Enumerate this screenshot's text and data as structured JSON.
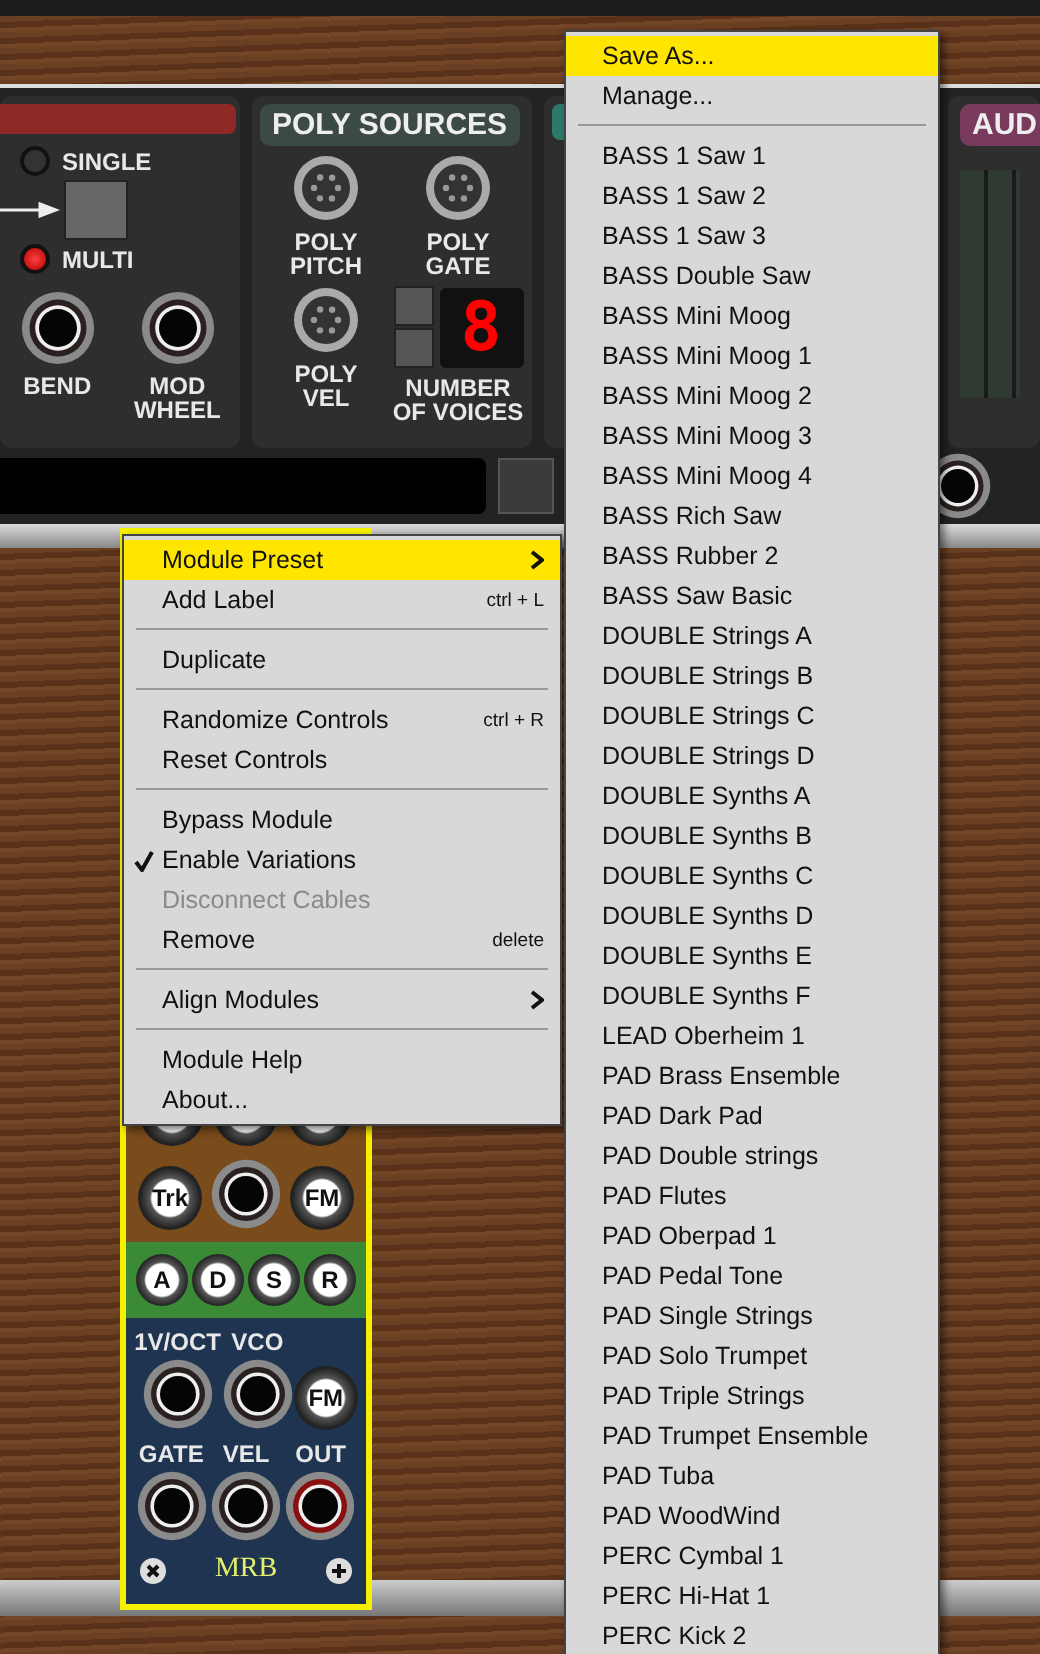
{
  "rack": {
    "input_module": {
      "leds": [
        {
          "label": "SINGLE",
          "on": false
        },
        {
          "label": "MULTI",
          "on": true
        }
      ],
      "jacks": [
        "BEND",
        "MOD WHEEL"
      ]
    },
    "poly_sources": {
      "title": "POLY SOURCES",
      "ports": [
        "POLY PITCH",
        "POLY GATE",
        "POLY VEL"
      ],
      "voices_label": "NUMBER OF VOICES",
      "voices_display": "8"
    },
    "audio_module": {
      "title": "AUD"
    }
  },
  "module": {
    "name": "MRB",
    "selected": true,
    "sections": [
      {
        "color": "#7a4c1c",
        "rows": [
          [
            {
              "kind": "knob"
            },
            {
              "kind": "knob"
            },
            {
              "kind": "knob"
            }
          ],
          [
            {
              "kind": "knob",
              "label": "Trk"
            },
            {
              "kind": "jack"
            },
            {
              "kind": "knob",
              "label": "FM"
            }
          ]
        ]
      },
      {
        "color": "#3a8a36",
        "rows": [
          [
            {
              "kind": "knob",
              "label": "A"
            },
            {
              "kind": "knob",
              "label": "D"
            },
            {
              "kind": "knob",
              "label": "S"
            },
            {
              "kind": "knob",
              "label": "R"
            }
          ]
        ]
      },
      {
        "color": "#1e3450",
        "rows": [
          [
            {
              "kind": "jack",
              "caption": "1V/OCT",
              "output": false
            },
            {
              "kind": "jack",
              "caption": "VCO",
              "output": false
            },
            {
              "kind": "knob",
              "label": "FM"
            }
          ],
          [
            {
              "kind": "jack",
              "caption": "GATE",
              "output": false
            },
            {
              "kind": "jack",
              "caption": "VEL",
              "output": false
            },
            {
              "kind": "jack",
              "caption": "OUT",
              "output": true
            }
          ]
        ]
      }
    ]
  },
  "context_menu": {
    "items": [
      {
        "kind": "item",
        "label": "Module Preset",
        "submenu": true,
        "selected": true,
        "checked": false,
        "disabled": false
      },
      {
        "kind": "item",
        "label": "Add Label",
        "shortcut": "ctrl + L",
        "submenu": false,
        "selected": false,
        "checked": false,
        "disabled": false
      },
      {
        "kind": "separator"
      },
      {
        "kind": "item",
        "label": "Duplicate",
        "submenu": false,
        "selected": false,
        "checked": false,
        "disabled": false
      },
      {
        "kind": "separator"
      },
      {
        "kind": "item",
        "label": "Randomize Controls",
        "shortcut": "ctrl + R",
        "submenu": false,
        "selected": false,
        "checked": false,
        "disabled": false
      },
      {
        "kind": "item",
        "label": "Reset Controls",
        "submenu": false,
        "selected": false,
        "checked": false,
        "disabled": false
      },
      {
        "kind": "separator"
      },
      {
        "kind": "item",
        "label": "Bypass Module",
        "submenu": false,
        "selected": false,
        "checked": false,
        "disabled": false
      },
      {
        "kind": "item",
        "label": "Enable Variations",
        "submenu": false,
        "selected": false,
        "checked": true,
        "disabled": false
      },
      {
        "kind": "item",
        "label": "Disconnect Cables",
        "submenu": false,
        "selected": false,
        "checked": false,
        "disabled": true
      },
      {
        "kind": "item",
        "label": "Remove",
        "shortcut": "delete",
        "submenu": false,
        "selected": false,
        "checked": false,
        "disabled": false
      },
      {
        "kind": "separator"
      },
      {
        "kind": "item",
        "label": "Align Modules",
        "submenu": true,
        "selected": false,
        "checked": false,
        "disabled": false
      },
      {
        "kind": "separator"
      },
      {
        "kind": "item",
        "label": "Module Help",
        "submenu": false,
        "selected": false,
        "checked": false,
        "disabled": false
      },
      {
        "kind": "item",
        "label": "About...",
        "submenu": false,
        "selected": false,
        "checked": false,
        "disabled": false
      }
    ]
  },
  "preset_menu": {
    "items": [
      {
        "kind": "item",
        "label": "Save As...",
        "selected": true
      },
      {
        "kind": "item",
        "label": "Manage...",
        "selected": false
      },
      {
        "kind": "separator"
      },
      {
        "kind": "item",
        "label": "BASS 1 Saw 1",
        "selected": false
      },
      {
        "kind": "item",
        "label": "BASS 1 Saw 2",
        "selected": false
      },
      {
        "kind": "item",
        "label": "BASS 1 Saw 3",
        "selected": false
      },
      {
        "kind": "item",
        "label": "BASS Double Saw",
        "selected": false
      },
      {
        "kind": "item",
        "label": "BASS Mini Moog",
        "selected": false
      },
      {
        "kind": "item",
        "label": "BASS Mini Moog 1",
        "selected": false
      },
      {
        "kind": "item",
        "label": "BASS Mini Moog 2",
        "selected": false
      },
      {
        "kind": "item",
        "label": "BASS Mini Moog 3",
        "selected": false
      },
      {
        "kind": "item",
        "label": "BASS Mini Moog 4",
        "selected": false
      },
      {
        "kind": "item",
        "label": "BASS Rich Saw",
        "selected": false
      },
      {
        "kind": "item",
        "label": "BASS Rubber 2",
        "selected": false
      },
      {
        "kind": "item",
        "label": "BASS Saw Basic",
        "selected": false
      },
      {
        "kind": "item",
        "label": "DOUBLE Strings A",
        "selected": false
      },
      {
        "kind": "item",
        "label": "DOUBLE Strings B",
        "selected": false
      },
      {
        "kind": "item",
        "label": "DOUBLE Strings C",
        "selected": false
      },
      {
        "kind": "item",
        "label": "DOUBLE Strings D",
        "selected": false
      },
      {
        "kind": "item",
        "label": "DOUBLE Synths A",
        "selected": false
      },
      {
        "kind": "item",
        "label": "DOUBLE Synths B",
        "selected": false
      },
      {
        "kind": "item",
        "label": "DOUBLE Synths C",
        "selected": false
      },
      {
        "kind": "item",
        "label": "DOUBLE Synths D",
        "selected": false
      },
      {
        "kind": "item",
        "label": "DOUBLE Synths E",
        "selected": false
      },
      {
        "kind": "item",
        "label": "DOUBLE Synths F",
        "selected": false
      },
      {
        "kind": "item",
        "label": "LEAD Oberheim 1",
        "selected": false
      },
      {
        "kind": "item",
        "label": "PAD Brass Ensemble",
        "selected": false
      },
      {
        "kind": "item",
        "label": "PAD Dark Pad",
        "selected": false
      },
      {
        "kind": "item",
        "label": "PAD Double strings",
        "selected": false
      },
      {
        "kind": "item",
        "label": "PAD Flutes",
        "selected": false
      },
      {
        "kind": "item",
        "label": "PAD Oberpad 1",
        "selected": false
      },
      {
        "kind": "item",
        "label": "PAD Pedal Tone",
        "selected": false
      },
      {
        "kind": "item",
        "label": "PAD Single Strings",
        "selected": false
      },
      {
        "kind": "item",
        "label": "PAD Solo Trumpet",
        "selected": false
      },
      {
        "kind": "item",
        "label": "PAD Triple Strings",
        "selected": false
      },
      {
        "kind": "item",
        "label": "PAD Trumpet Ensemble",
        "selected": false
      },
      {
        "kind": "item",
        "label": "PAD Tuba",
        "selected": false
      },
      {
        "kind": "item",
        "label": "PAD WoodWind",
        "selected": false
      },
      {
        "kind": "item",
        "label": "PERC Cymbal 1",
        "selected": false
      },
      {
        "kind": "item",
        "label": "PERC Hi-Hat 1",
        "selected": false
      },
      {
        "kind": "item",
        "label": "PERC Kick 2",
        "selected": false
      }
    ]
  }
}
